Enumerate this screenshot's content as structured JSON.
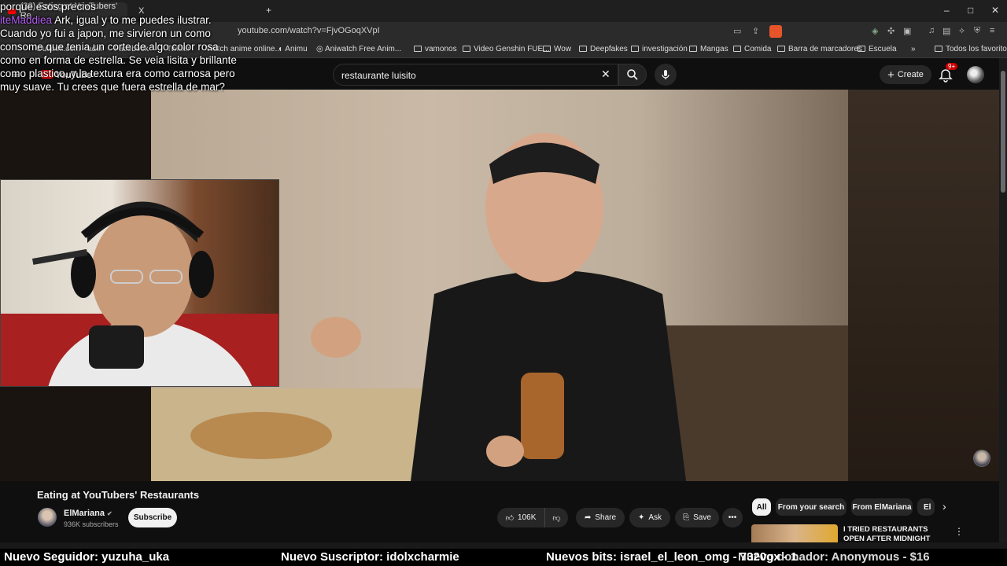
{
  "browser": {
    "tabs": [
      {
        "label": "(38) Eating at YouTubers' Re"
      },
      {
        "label": "X"
      }
    ],
    "url": "youtube.com/watch?v=FjvOGoqXVpI",
    "bookmarks": [
      {
        "label": "Outlook.com - ader"
      },
      {
        "label": "Facebook"
      },
      {
        "label": "Twitter"
      },
      {
        "label": "Watch anime online..."
      },
      {
        "label": "Animu"
      },
      {
        "label": "Aniwatch Free Anim..."
      },
      {
        "label": "vamonos"
      },
      {
        "label": "Video Genshin FUE..."
      },
      {
        "label": "Wow"
      },
      {
        "label": "Deepfakes"
      },
      {
        "label": "investigación"
      },
      {
        "label": "Mangas"
      },
      {
        "label": "Comida"
      },
      {
        "label": "Barra de marcadores"
      },
      {
        "label": "Escuela"
      },
      {
        "label": "Todos los favoritos"
      }
    ]
  },
  "youtube": {
    "logo": "YouTube",
    "search_value": "restaurante luisito",
    "create_label": "Create",
    "notification_count": "9+"
  },
  "chat_overlay": {
    "line1": "porque esos precios",
    "name": "iteMaddiea",
    "message": "Ark, igual y to me puedes ilustrar. Cuando yo fui a japon, me sirvieron un como consome que tenia un corte de algo color rosa como en forma de estrella. Se veia lisita y brillante como plastico, y la textura era como carnosa pero muy suave. Tu crees que fuera estrella de mar?"
  },
  "video": {
    "title": "Eating at YouTubers' Restaurants",
    "channel": "ElMariana",
    "subscribers": "936K subscribers",
    "subscribe_label": "Subscribe",
    "likes": "106K",
    "share_label": "Share",
    "ask_label": "Ask",
    "save_label": "Save"
  },
  "recommendations": {
    "chips": [
      "All",
      "From your search",
      "From ElMariana",
      "El"
    ],
    "first_title": "I TRIED RESTAURANTS OPEN AFTER MIDNIGHT"
  },
  "ticker": {
    "follower": "Nuevo Seguidor: yuzuha_uka",
    "subscriber": "Nuevo Suscriptor: idolxcharmie",
    "bits": "Nuevos bits: israel_el_leon_omg - 7320gx - 1",
    "donor": "Nuevo donador: Anonymous - $16"
  },
  "colors": {
    "accent_red": "#cc0000",
    "chat_name": "#b25cf2",
    "background": "#0f0f0f"
  }
}
